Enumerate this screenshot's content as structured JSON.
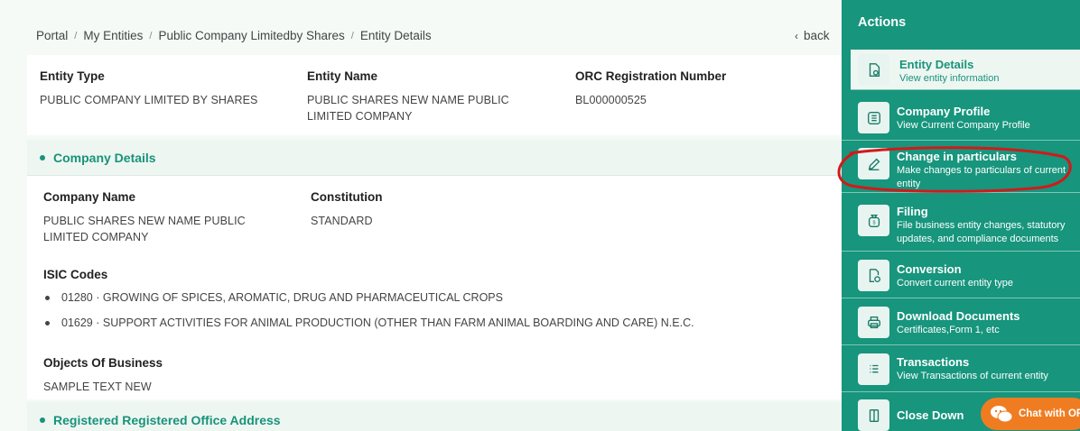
{
  "breadcrumb": [
    "Portal",
    "My Entities",
    "Public Company Limitedby Shares",
    "Entity Details"
  ],
  "back_label": "back",
  "top_info": {
    "entity_type_label": "Entity Type",
    "entity_type_value": "PUBLIC COMPANY LIMITED BY SHARES",
    "entity_name_label": "Entity Name",
    "entity_name_value": "PUBLIC SHARES NEW NAME PUBLIC LIMITED COMPANY",
    "orc_label": "ORC Registration Number",
    "orc_value": "BL000000525"
  },
  "company_details": {
    "heading": "Company Details",
    "company_name_label": "Company Name",
    "company_name_value": "PUBLIC SHARES NEW NAME PUBLIC LIMITED COMPANY",
    "constitution_label": "Constitution",
    "constitution_value": "STANDARD",
    "isic_label": "ISIC Codes",
    "isic_codes": [
      "01280 · GROWING OF SPICES, AROMATIC, DRUG AND PHARMACEUTICAL CROPS",
      "01629 · SUPPORT ACTIVITIES FOR ANIMAL PRODUCTION (OTHER THAN FARM ANIMAL BOARDING AND CARE) N.E.C."
    ],
    "objects_label": "Objects Of Business",
    "objects_value": "SAMPLE TEXT NEW"
  },
  "registered_office": {
    "heading": "Registered Registered Office Address"
  },
  "actions": {
    "title": "Actions",
    "items": [
      {
        "title": "Entity Details",
        "subtitle": "View entity information",
        "icon": "document-gear-icon"
      },
      {
        "title": "Company Profile",
        "subtitle": "View Current Company Profile",
        "icon": "list-icon"
      },
      {
        "title": "Change in particulars",
        "subtitle": "Make changes to particulars of current entity",
        "icon": "pencil-icon"
      },
      {
        "title": "Filing",
        "subtitle": "File business entity changes, statutory updates, and compliance documents",
        "icon": "money-bag-icon"
      },
      {
        "title": "Conversion",
        "subtitle": "Convert current entity type",
        "icon": "document-refresh-icon"
      },
      {
        "title": "Download Documents",
        "subtitle": "Certificates,Form 1, etc",
        "icon": "printer-icon"
      },
      {
        "title": "Transactions",
        "subtitle": "View Transactions of current entity",
        "icon": "list-lines-icon"
      },
      {
        "title": "Close Down",
        "subtitle": "",
        "icon": "door-icon"
      }
    ]
  },
  "chat_label": "Chat with ORC",
  "colors": {
    "brand": "#17957d",
    "accent_orange": "#f07c22",
    "annotation_red": "#d11a1a"
  }
}
